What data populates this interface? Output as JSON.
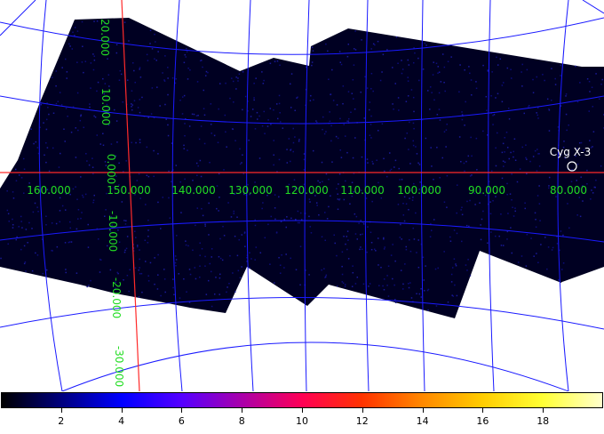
{
  "image": {
    "grid_color": "#1a1aff",
    "axis_color": "#ff2a2a",
    "label_color": "#22dd22",
    "map_background": "#000022"
  },
  "axis_labels": {
    "longitude": [
      "160.000",
      "150.000",
      "140.000",
      "130.000",
      "120.000",
      "110.000",
      "100.000",
      "90.000",
      "80.000"
    ],
    "latitude": [
      "20.000",
      "10.000",
      "0.000",
      "-10.000",
      "-20.000",
      "-30.000"
    ]
  },
  "source": {
    "name": "Cyg X-3",
    "marker_color": "#ffffff"
  },
  "colorbar": {
    "colors": [
      "#000000",
      "#00007f",
      "#0000ff",
      "#5500ff",
      "#aa00aa",
      "#ff0055",
      "#ff3300",
      "#ff8800",
      "#ffcc00",
      "#ffff33",
      "#ffffcc"
    ],
    "tick_labels": [
      "2",
      "4",
      "6",
      "8",
      "10",
      "12",
      "14",
      "16",
      "18"
    ],
    "min": 0,
    "max": 20
  }
}
